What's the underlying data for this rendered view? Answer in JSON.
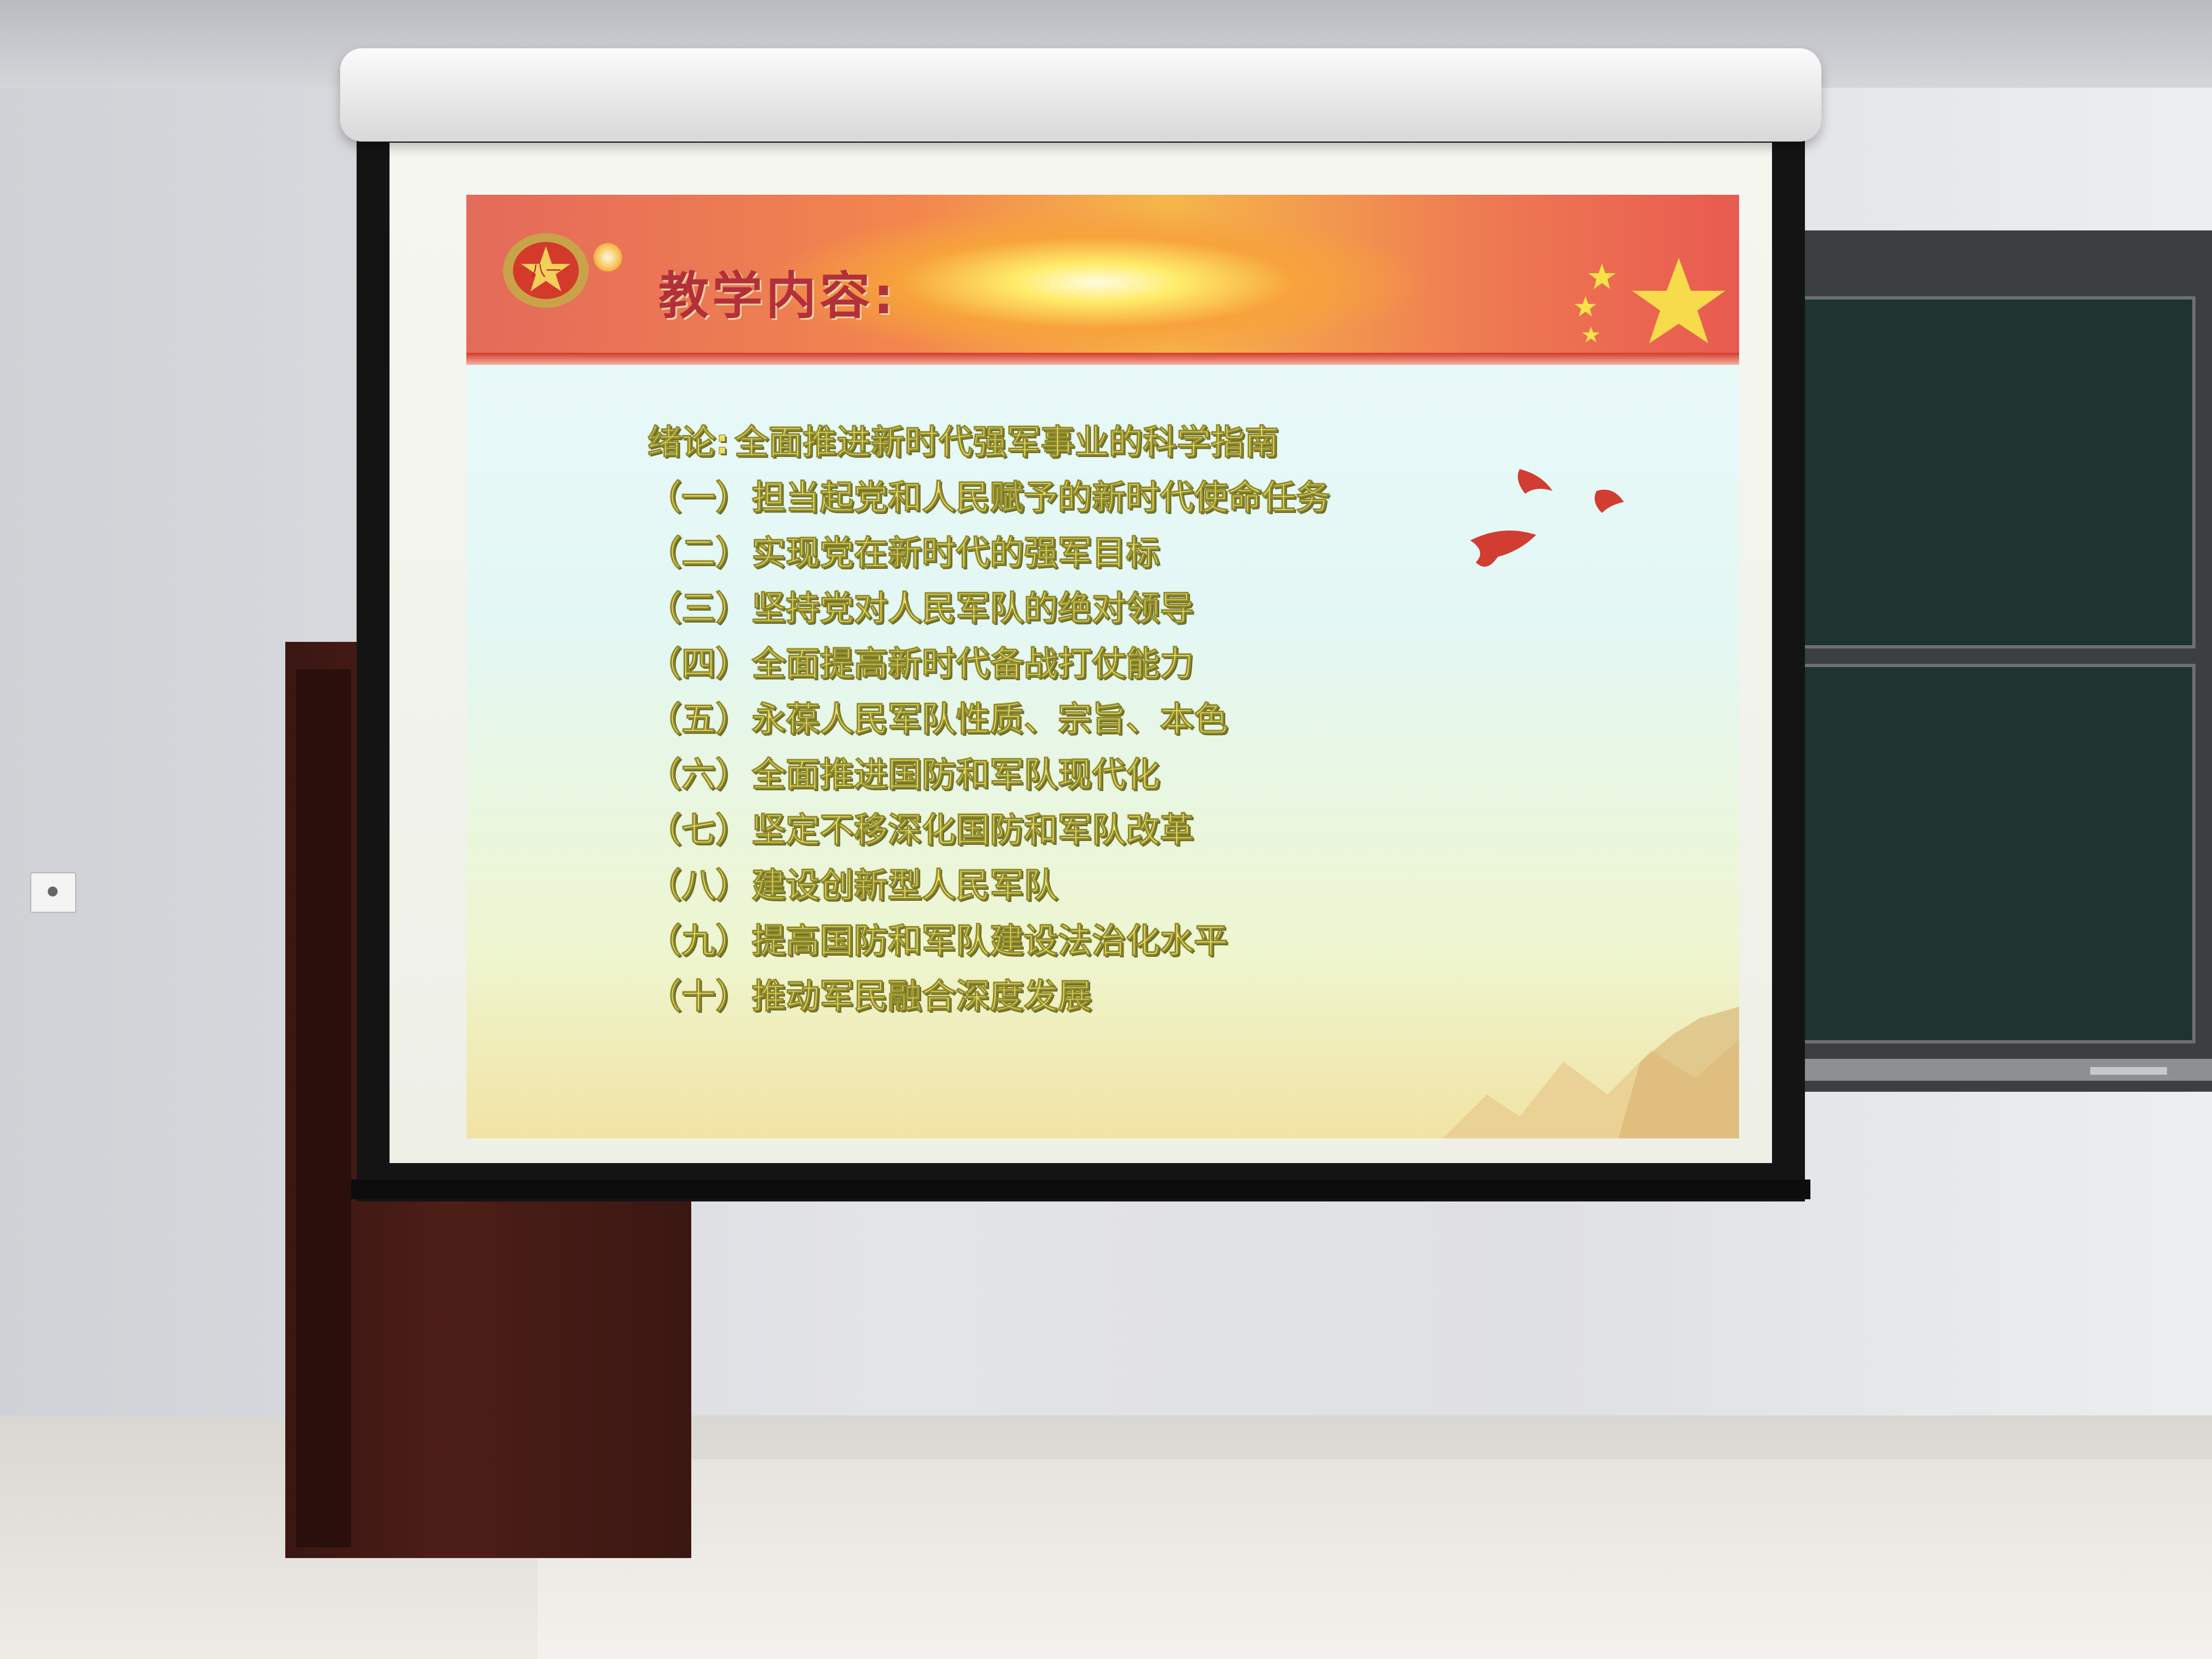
{
  "slide": {
    "title": "教学内容:",
    "intro": {
      "label": "绪论:",
      "text": "全面推进新时代强军事业的科学指南"
    },
    "items": [
      {
        "index": "（一）",
        "text": "担当起党和人民赋予的新时代使命任务"
      },
      {
        "index": "（二）",
        "text": "实现党在新时代的强军目标"
      },
      {
        "index": "（三）",
        "text": "坚持党对人民军队的绝对领导"
      },
      {
        "index": "（四）",
        "text": "全面提高新时代备战打仗能力"
      },
      {
        "index": "（五）",
        "text": "永葆人民军队性质、宗旨、本色"
      },
      {
        "index": "（六）",
        "text": "全面推进国防和军队现代化"
      },
      {
        "index": "（七）",
        "text": "坚定不移深化国防和军队改革"
      },
      {
        "index": "（八）",
        "text": "建设创新型人民军队"
      },
      {
        "index": "（九）",
        "text": "提高国防和军队建设法治化水平"
      },
      {
        "index": "（十）",
        "text": "推动军民融合深度发展"
      }
    ]
  },
  "colors": {
    "title": "#b3303b",
    "list_text": "#ece06b",
    "banner_red": "#e46a5a",
    "banner_gold": "#f6b64a"
  },
  "icons": [
    "army-emblem-icon",
    "star-icon",
    "dove-icon",
    "great-wall-icon"
  ]
}
